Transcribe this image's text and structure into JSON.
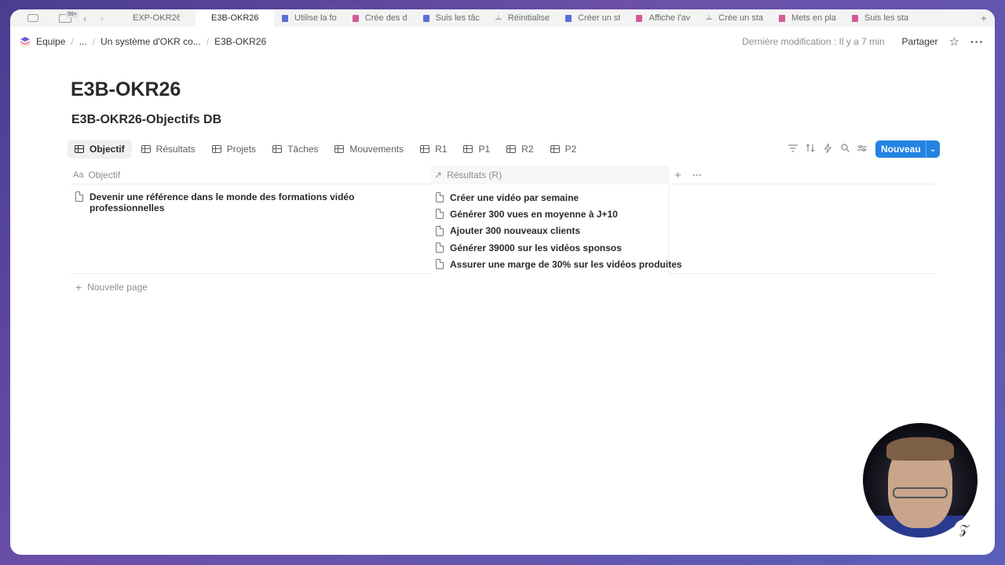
{
  "browser": {
    "tab_badge": "99+",
    "tabs": [
      {
        "label": "EXP-OKR26",
        "icon": "none",
        "active": false
      },
      {
        "label": "E3B-OKR26",
        "icon": "none",
        "active": true
      },
      {
        "label": "Utilise la fo",
        "icon": "blue",
        "active": false
      },
      {
        "label": "Crée des d",
        "icon": "pink",
        "active": false
      },
      {
        "label": "Suis les tâc",
        "icon": "blue",
        "active": false
      },
      {
        "label": "Réinitialise",
        "icon": "gray",
        "active": false
      },
      {
        "label": "Créer un st",
        "icon": "blue",
        "active": false
      },
      {
        "label": "Affiche l'av",
        "icon": "pink",
        "active": false
      },
      {
        "label": "Crée un sta",
        "icon": "gray",
        "active": false
      },
      {
        "label": "Mets en pla",
        "icon": "pink",
        "active": false
      },
      {
        "label": "Suis les sta",
        "icon": "pink",
        "active": false
      }
    ]
  },
  "breadcrumb": {
    "workspace": "Equipe",
    "ellipsis": "...",
    "parent": "Un système d'OKR co...",
    "current": "E3B-OKR26"
  },
  "topbar": {
    "last_modified": "Dernière modification : Il y a 7 min",
    "share_label": "Partager"
  },
  "page": {
    "title": "E3B-OKR26",
    "database_title": "E3B-OKR26-Objectifs DB"
  },
  "views": [
    {
      "label": "Objectif",
      "active": true
    },
    {
      "label": "Résultats",
      "active": false
    },
    {
      "label": "Projets",
      "active": false
    },
    {
      "label": "Tâches",
      "active": false
    },
    {
      "label": "Mouvements",
      "active": false
    },
    {
      "label": "R1",
      "active": false
    },
    {
      "label": "P1",
      "active": false
    },
    {
      "label": "R2",
      "active": false
    },
    {
      "label": "P2",
      "active": false
    }
  ],
  "toolbar": {
    "new_label": "Nouveau"
  },
  "table": {
    "columns": {
      "objective": "Objectif",
      "results": "Résultats (R)"
    },
    "rows": [
      {
        "objective": "Devenir une référence dans le monde des formations vidéo professionnelles",
        "results": [
          "Créer une vidéo par semaine",
          "Générer 300 vues en moyenne à J+10",
          "Ajouter 300 nouveaux clients",
          "Générer 39000 sur les vidéos sponsos",
          "Assurer une marge de 30% sur les vidéos produites"
        ]
      }
    ],
    "new_page_label": "Nouvelle page"
  },
  "colors": {
    "accent": "#2383e2",
    "text": "#37352f",
    "muted": "#8f8e8b"
  }
}
